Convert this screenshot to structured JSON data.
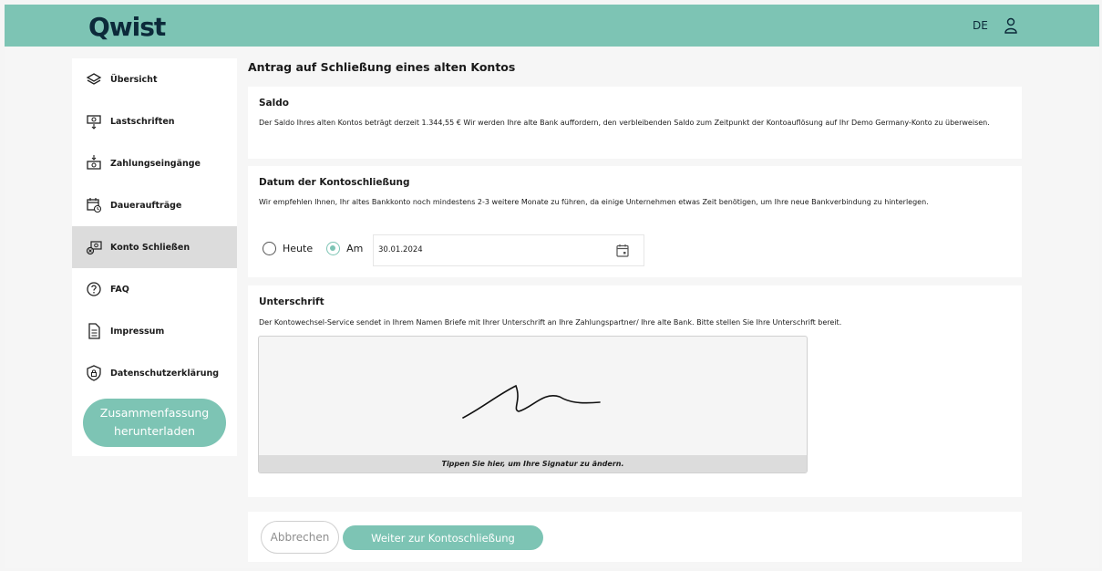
{
  "brand": {
    "logo": "Qwist",
    "accent_color": "#7dc4b4"
  },
  "header": {
    "language": "DE",
    "user_icon": "user-icon"
  },
  "sidebar": {
    "items": [
      {
        "label": "Übersicht",
        "icon": "layers-icon"
      },
      {
        "label": "Lastschriften",
        "icon": "money-out-icon"
      },
      {
        "label": "Zahlungseingänge",
        "icon": "money-in-icon"
      },
      {
        "label": "Daueraufträge",
        "icon": "calendar-clock-icon"
      },
      {
        "label": "Konto Schließen",
        "icon": "close-account-icon",
        "active": true
      },
      {
        "label": "FAQ",
        "icon": "help-icon"
      },
      {
        "label": "Impressum",
        "icon": "document-icon"
      },
      {
        "label": "Datenschutzerklärung",
        "icon": "shield-icon"
      }
    ],
    "summary_button": {
      "line1": "Zusammenfassung",
      "line2": "herunterladen"
    }
  },
  "main": {
    "title": "Antrag auf Schließung eines alten Kontos",
    "saldo": {
      "title": "Saldo",
      "text": "Der Saldo Ihres alten Kontos beträgt derzeit 1.344,55 € Wir werden Ihre alte Bank auffordern, den verbleibenden Saldo zum Zeitpunkt der Kontoauflösung auf Ihr Demo Germany-Konto zu überweisen."
    },
    "date_section": {
      "title": "Datum der Kontoschließung",
      "text": "Wir empfehlen Ihnen, Ihr altes Bankkonto noch mindestens 2-3 weitere Monate zu führen, da einige Unternehmen etwas Zeit benötigen, um Ihre neue Bankverbindung zu hinterlegen.",
      "option_today": "Heute",
      "option_on": "Am",
      "selected_option": "Am",
      "date_value": "30.01.2024"
    },
    "signature": {
      "title": "Unterschrift",
      "text": "Der Kontowechsel-Service sendet in Ihrem Namen Briefe mit Ihrer Unterschrift an Ihre Zahlungspartner/ Ihre alte Bank. Bitte stellen Sie Ihre Unterschrift bereit.",
      "caption": "Tippen Sie hier, um Ihre Signatur zu ändern."
    }
  },
  "footer": {
    "cancel_label": "Abbrechen",
    "next_label": "Weiter zur Kontoschließung"
  }
}
